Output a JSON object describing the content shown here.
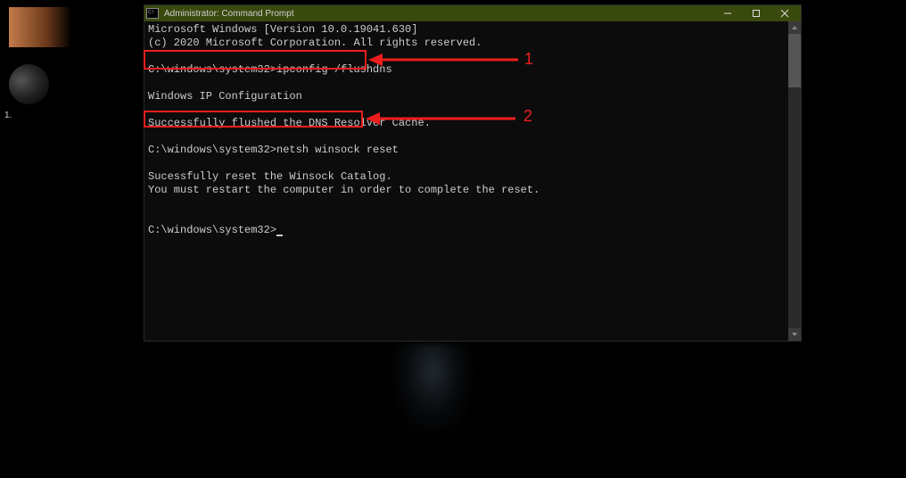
{
  "desktop": {
    "label1": "1."
  },
  "window": {
    "title": "Administrator: Command Prompt"
  },
  "terminal": {
    "line1": "Microsoft Windows [Version 10.0.19041.630]",
    "line2": "(c) 2020 Microsoft Corporation. All rights reserved.",
    "prompt1": "C:\\windows\\system32>",
    "cmd1": "ipconfig /flushdns",
    "out1": "Windows IP Configuration",
    "out2": "Successfully flushed the DNS Resolver Cache.",
    "prompt2": "C:\\windows\\system32>",
    "cmd2": "netsh winsock reset",
    "out3": "Sucessfully reset the Winsock Catalog.",
    "out4": "You must restart the computer in order to complete the reset.",
    "prompt3": "C:\\windows\\system32>"
  },
  "annotations": {
    "num1": "1",
    "num2": "2"
  },
  "colors": {
    "highlight": "#ee1d1d",
    "titlebar": "#3a4a0e"
  }
}
